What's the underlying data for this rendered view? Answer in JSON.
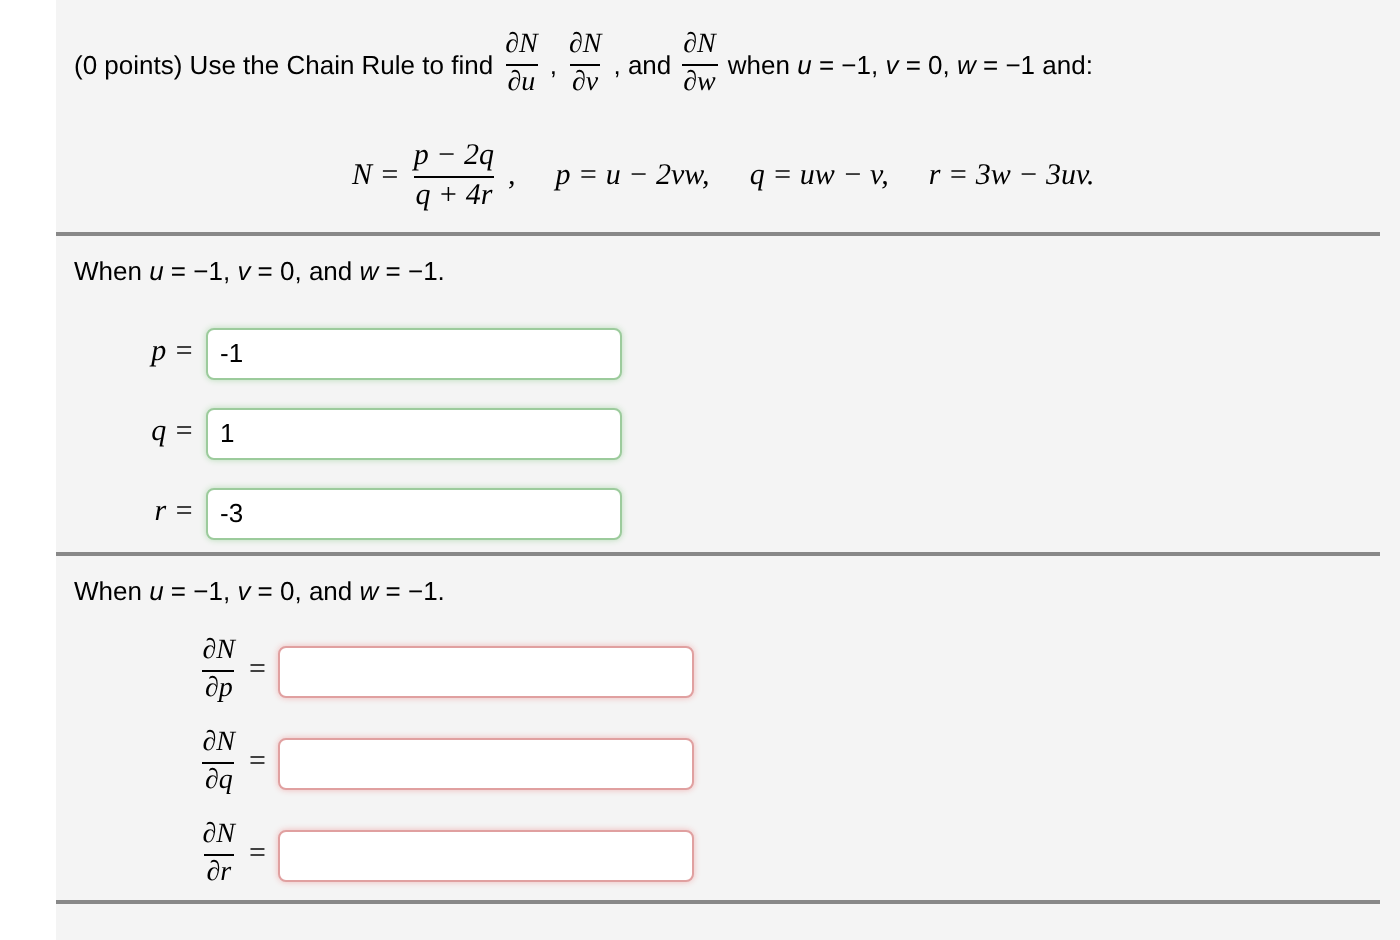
{
  "intro": [
    {
      "kind": "text",
      "text": "(0 points) Use the Chain Rule to find"
    },
    {
      "kind": "fraction",
      "num": "∂N",
      "den": "∂u"
    },
    {
      "kind": "text",
      "text": ","
    },
    {
      "kind": "fraction",
      "num": "∂N",
      "den": "∂v"
    },
    {
      "kind": "text",
      "text": ", and"
    },
    {
      "kind": "fraction",
      "num": "∂N",
      "den": "∂w"
    },
    {
      "kind": "text",
      "text": "when *u* = −1, *v* = 0, *w* = −1 and:"
    }
  ],
  "formula": [
    {
      "kind": "text",
      "text": "N ="
    },
    {
      "kind": "fraction",
      "num": "p − 2q",
      "den": "q + 4r"
    },
    {
      "kind": "text",
      "text": ","
    },
    {
      "kind": "text",
      "text": "p = u − 2vw,"
    },
    {
      "kind": "text",
      "text": "q = uw − v,"
    },
    {
      "kind": "text",
      "text": "r = 3w − 3uv."
    }
  ],
  "sections": [
    {
      "heading": "When *u* = −1, *v* = 0, and *w* = −1.",
      "fields": [
        {
          "label": {
            "kind": "text",
            "text": "p ="
          },
          "value": "-1",
          "correct": true
        },
        {
          "label": {
            "kind": "text",
            "text": "q ="
          },
          "value": "1",
          "correct": true
        },
        {
          "label": {
            "kind": "text",
            "text": "r ="
          },
          "value": "-3",
          "correct": true
        }
      ]
    },
    {
      "heading": "When *u* = −1, *v* = 0, and *w* = −1.",
      "fields": [
        {
          "label": {
            "kind": "fraction",
            "num": "∂N",
            "den": "∂p",
            "equals": "="
          },
          "correct": false
        },
        {
          "label": {
            "kind": "fraction",
            "num": "∂N",
            "den": "∂q",
            "equals": "="
          },
          "correct": false
        },
        {
          "label": {
            "kind": "fraction",
            "num": "∂N",
            "den": "∂r",
            "equals": "="
          },
          "correct": false
        }
      ]
    }
  ]
}
